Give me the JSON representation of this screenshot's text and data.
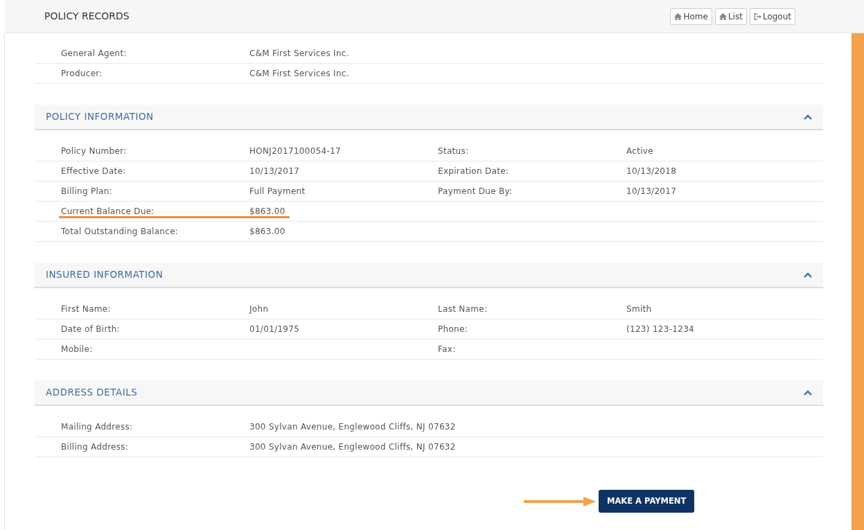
{
  "header": {
    "title": "POLICY RECORDS",
    "buttons": [
      {
        "label": "Home",
        "kind": "home"
      },
      {
        "label": "List",
        "kind": "home"
      },
      {
        "label": "Logout",
        "kind": "logout"
      }
    ]
  },
  "agent_rows": [
    {
      "label": "General Agent:",
      "value": "C&M First Services Inc."
    },
    {
      "label": "Producer:",
      "value": "C&M First Services Inc."
    }
  ],
  "sections": [
    {
      "title": "POLICY INFORMATION",
      "expanded": true,
      "rows": [
        {
          "label": "Policy Number:",
          "value": "HONJ2017100054-17",
          "label_2": "Status:",
          "value_2": "Active",
          "highlighted": false
        },
        {
          "label": "Effective Date:",
          "value": "10/13/2017",
          "label_2": "Expiration Date:",
          "value_2": "10/13/2018",
          "highlighted": false
        },
        {
          "label": "Billing Plan:",
          "value": "Full Payment",
          "label_2": "Payment Due By:",
          "value_2": "10/13/2017",
          "highlighted": false
        },
        {
          "label": "Current Balance Due:",
          "value": "$863.00",
          "highlighted": true
        },
        {
          "label": "Total Outstanding Balance:",
          "value": "$863.00",
          "highlighted": false
        }
      ]
    },
    {
      "title": "INSURED INFORMATION",
      "expanded": true,
      "rows": [
        {
          "label": "First Name:",
          "value": "John",
          "label_2": "Last Name:",
          "value_2": "Smith",
          "highlighted": false
        },
        {
          "label": "Date of Birth:",
          "value": "01/01/1975",
          "label_2": "Phone:",
          "value_2": "(123) 123-1234",
          "highlighted": false
        },
        {
          "label": "Mobile:",
          "label_2": "Fax:",
          "highlighted": false
        }
      ]
    },
    {
      "title": "ADDRESS DETAILS",
      "expanded": true,
      "rows": [
        {
          "label": "Mailing Address:",
          "value": "300 Sylvan Avenue, Englewood Cliffs, NJ 07632",
          "highlighted": false
        },
        {
          "label": "Billing Address:",
          "value": "300 Sylvan Avenue, Englewood Cliffs, NJ 07632",
          "highlighted": false
        }
      ]
    }
  ],
  "payment": {
    "label": "MAKE A PAYMENT",
    "pointer_arrow": true
  }
}
